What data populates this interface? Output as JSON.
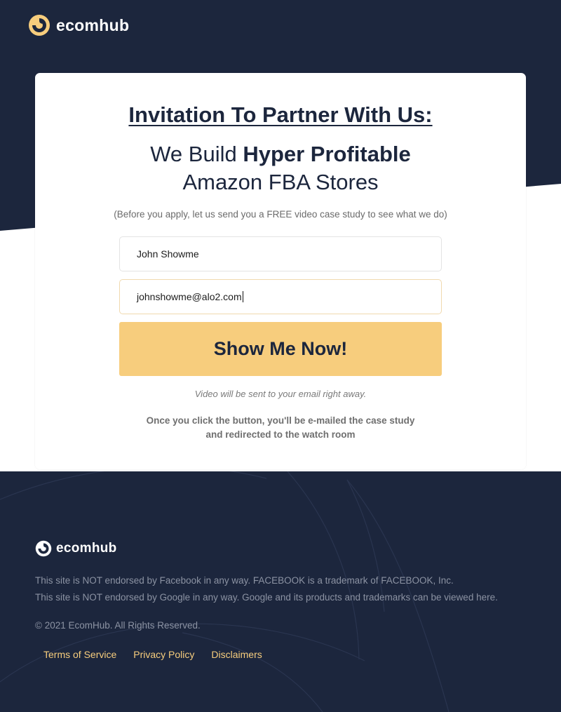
{
  "brand": {
    "name": "ecomhub",
    "logo_icon": "ecomhub-logo-icon",
    "color_dark": "#1c263d",
    "color_accent": "#f7cd7d"
  },
  "card": {
    "headline": "Invitation To Partner With Us:",
    "subhead_pre": "We Build ",
    "subhead_bold": "Hyper Profitable",
    "subhead_line2": "Amazon FBA Stores",
    "note": "(Before you apply, let us send you a FREE video case study to see what we do)"
  },
  "form": {
    "name_value": "John Showme",
    "email_value": "johnshowme@alo2.com",
    "submit_label": "Show Me Now!",
    "delivery_note": "Video will be sent to your email right away.",
    "redirect_note": "Once you click the button, you'll be e-mailed the case study and redirected to the watch room"
  },
  "footer": {
    "disclaimer_facebook": "This site is NOT endorsed by Facebook in any way. FACEBOOK is a trademark of FACEBOOK, Inc.",
    "disclaimer_google": "This site is NOT endorsed by Google in any way. Google and its products and trademarks can be viewed here.",
    "copyright": "© 2021 EcomHub. All Rights Reserved.",
    "links": [
      "Terms of Service",
      "Privacy Policy",
      "Disclaimers"
    ]
  }
}
